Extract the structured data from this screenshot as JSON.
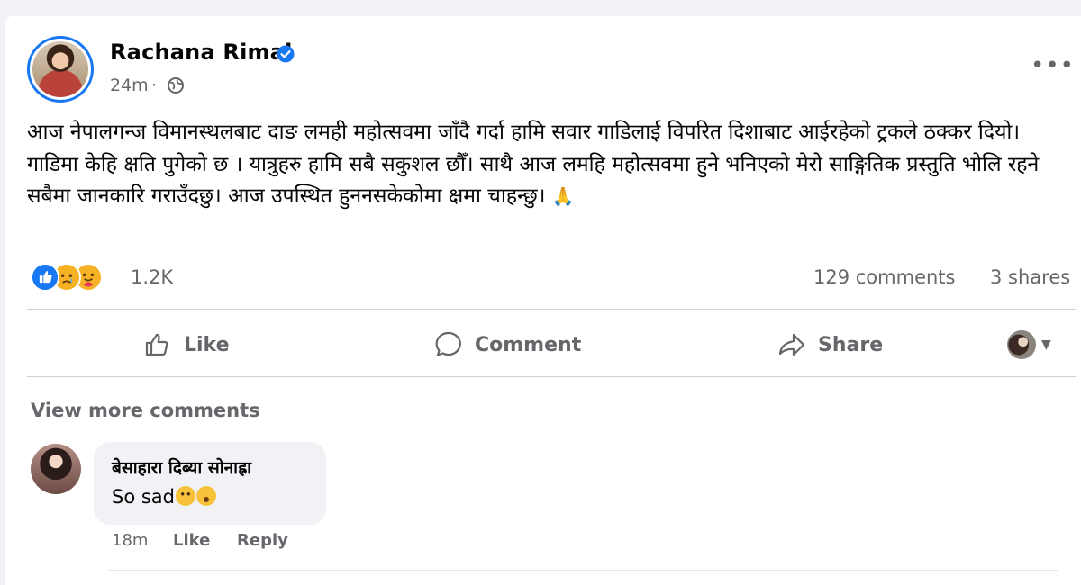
{
  "post": {
    "author": "Rachana Rimal",
    "time": "24m",
    "separator": "·",
    "text": "आज नेपालगन्ज विमानस्थलबाट दाङ लमही महोत्सवमा जाँदै गर्दा हामि सवार गाडिलाई विपरित दिशाबाट आईरहेको ट्रकले ठक्कर दियो। गाडिमा केहि क्षति पुगेको छ । यात्रुहरु हामि सबै सकुशल छौँ। साथै आज लमहि महोत्सवमा हुने भनिएको मेरो साङ्गितिक प्रस्तुति भोलि रहने सबैमा जानकारि गराउँदछु। आज उपस्थित हुननसकेकोमा क्षमा चाहन्छु।",
    "text_emoji": "🙏",
    "more_label": "•••",
    "icons": {
      "verified": "verified-badge-icon",
      "audience": "globe-icon",
      "more": "more-options-icon"
    }
  },
  "stats": {
    "reaction_count": "1.2K",
    "comments": "129 comments",
    "shares": "3 shares",
    "reactions": [
      "like",
      "sad",
      "care"
    ]
  },
  "actions": {
    "like": "Like",
    "comment": "Comment",
    "share": "Share"
  },
  "comments": {
    "view_more": "View more comments",
    "items": [
      {
        "author": "बेसाहारा दिब्या सोनाह्रा",
        "text": "So sad",
        "emojis": [
          "sad",
          "crying"
        ],
        "time": "18m",
        "like": "Like",
        "reply": "Reply"
      }
    ]
  },
  "colors": {
    "accent": "#1877f2",
    "text_primary": "#050505",
    "text_secondary": "#65676b",
    "bubble": "#f0f2f5"
  }
}
